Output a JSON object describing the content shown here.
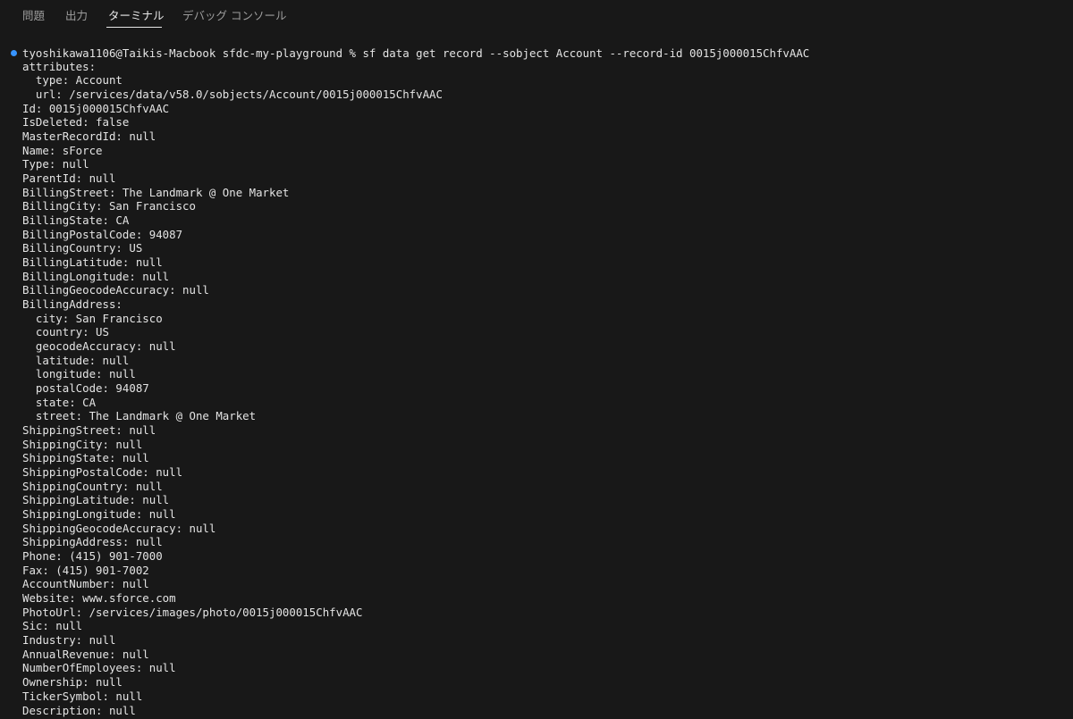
{
  "tabs": [
    {
      "label": "問題",
      "active": false
    },
    {
      "label": "出力",
      "active": false
    },
    {
      "label": "ターミナル",
      "active": true
    },
    {
      "label": "デバッグ コンソール",
      "active": false
    }
  ],
  "terminal": {
    "command": "tyoshikawa1106@Taikis-Macbook sfdc-my-playground % sf data get record --sobject Account --record-id 0015j000015ChfvAAC",
    "output": [
      "attributes:",
      "  type: Account",
      "  url: /services/data/v58.0/sobjects/Account/0015j000015ChfvAAC",
      "Id: 0015j000015ChfvAAC",
      "IsDeleted: false",
      "MasterRecordId: null",
      "Name: sForce",
      "Type: null",
      "ParentId: null",
      "BillingStreet: The Landmark @ One Market",
      "BillingCity: San Francisco",
      "BillingState: CA",
      "BillingPostalCode: 94087",
      "BillingCountry: US",
      "BillingLatitude: null",
      "BillingLongitude: null",
      "BillingGeocodeAccuracy: null",
      "BillingAddress:",
      "  city: San Francisco",
      "  country: US",
      "  geocodeAccuracy: null",
      "  latitude: null",
      "  longitude: null",
      "  postalCode: 94087",
      "  state: CA",
      "  street: The Landmark @ One Market",
      "ShippingStreet: null",
      "ShippingCity: null",
      "ShippingState: null",
      "ShippingPostalCode: null",
      "ShippingCountry: null",
      "ShippingLatitude: null",
      "ShippingLongitude: null",
      "ShippingGeocodeAccuracy: null",
      "ShippingAddress: null",
      "Phone: (415) 901-7000",
      "Fax: (415) 901-7002",
      "AccountNumber: null",
      "Website: www.sforce.com",
      "PhotoUrl: /services/images/photo/0015j000015ChfvAAC",
      "Sic: null",
      "Industry: null",
      "AnnualRevenue: null",
      "NumberOfEmployees: null",
      "Ownership: null",
      "TickerSymbol: null",
      "Description: null"
    ]
  }
}
